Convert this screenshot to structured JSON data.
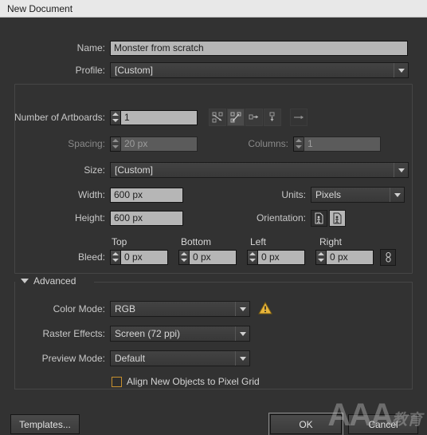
{
  "window": {
    "title": "New Document"
  },
  "fields": {
    "name": {
      "label": "Name:",
      "value": "Monster from scratch"
    },
    "profile": {
      "label": "Profile:",
      "value": "[Custom]"
    },
    "artboards": {
      "label": "Number of Artboards:",
      "value": "1"
    },
    "spacing": {
      "label": "Spacing:",
      "value": "20 px"
    },
    "columns": {
      "label": "Columns:",
      "value": "1"
    },
    "size": {
      "label": "Size:",
      "value": "[Custom]"
    },
    "width": {
      "label": "Width:",
      "value": "600 px"
    },
    "height": {
      "label": "Height:",
      "value": "600 px"
    },
    "units": {
      "label": "Units:",
      "value": "Pixels"
    },
    "orientation": {
      "label": "Orientation:"
    },
    "bleed": {
      "label": "Bleed:",
      "columns": [
        "Top",
        "Bottom",
        "Left",
        "Right"
      ],
      "values": [
        "0 px",
        "0 px",
        "0 px",
        "0 px"
      ]
    }
  },
  "arrange_icons": [
    "grid-by-row-icon",
    "grid-by-column-icon",
    "arrange-by-row-icon",
    "arrange-by-column-icon",
    "left-to-right-icon"
  ],
  "advanced": {
    "header": "Advanced",
    "color_mode": {
      "label": "Color Mode:",
      "value": "RGB"
    },
    "raster_effects": {
      "label": "Raster Effects:",
      "value": "Screen (72 ppi)"
    },
    "preview_mode": {
      "label": "Preview Mode:",
      "value": "Default"
    },
    "align_pixel_grid": {
      "label": "Align New Objects to Pixel Grid",
      "checked": false
    },
    "warning_icon": "warning-triangle-icon"
  },
  "buttons": {
    "templates": "Templates...",
    "ok": "OK",
    "cancel": "Cancel"
  },
  "watermark": {
    "latin": "AAA",
    "cjk": "教育"
  },
  "colors": {
    "dialog_bg": "#323232",
    "titlebar_bg": "#e8e8e8",
    "input_bg": "#b6b6b6",
    "input_disabled_bg": "#5b5b5b",
    "accent_warning": "#e8b53a",
    "checkbox_border": "#c68f2e"
  }
}
